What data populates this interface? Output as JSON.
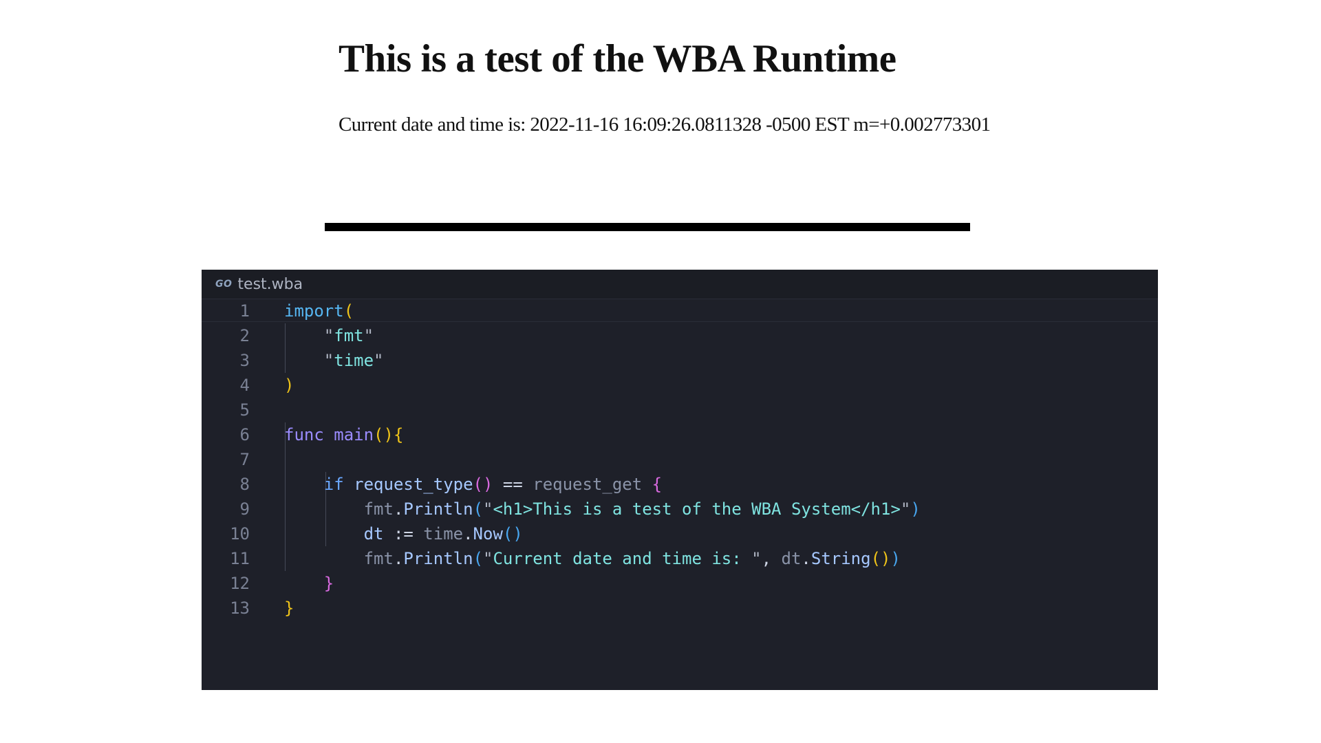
{
  "page": {
    "title": "This is a test of the WBA Runtime",
    "output_text": "Current date and time is: 2022-11-16 16:09:26.0811328 -0500 EST m=+0.002773301"
  },
  "editor": {
    "tab": {
      "icon": "GO",
      "filename": "test.wba"
    },
    "lines": [
      {
        "num": "1",
        "tokens": [
          {
            "t": "import",
            "c": "kw"
          },
          {
            "t": "(",
            "c": "p1"
          }
        ]
      },
      {
        "num": "2",
        "tokens": [
          {
            "t": "    ",
            "c": "op"
          },
          {
            "t": "\"",
            "c": "qt"
          },
          {
            "t": "fmt",
            "c": "str"
          },
          {
            "t": "\"",
            "c": "qt"
          }
        ]
      },
      {
        "num": "3",
        "tokens": [
          {
            "t": "    ",
            "c": "op"
          },
          {
            "t": "\"",
            "c": "qt"
          },
          {
            "t": "time",
            "c": "str"
          },
          {
            "t": "\"",
            "c": "qt"
          }
        ]
      },
      {
        "num": "4",
        "tokens": [
          {
            "t": ")",
            "c": "p1"
          }
        ]
      },
      {
        "num": "5",
        "tokens": []
      },
      {
        "num": "6",
        "tokens": [
          {
            "t": "func",
            "c": "pl"
          },
          {
            "t": " ",
            "c": "op"
          },
          {
            "t": "main",
            "c": "pl"
          },
          {
            "t": "()",
            "c": "p1"
          },
          {
            "t": "{",
            "c": "p1"
          }
        ]
      },
      {
        "num": "7",
        "tokens": []
      },
      {
        "num": "8",
        "tokens": [
          {
            "t": "    ",
            "c": "op"
          },
          {
            "t": "if",
            "c": "ctl"
          },
          {
            "t": " ",
            "c": "op"
          },
          {
            "t": "request_type",
            "c": "fn"
          },
          {
            "t": "()",
            "c": "p2"
          },
          {
            "t": " == ",
            "c": "op"
          },
          {
            "t": "request_get",
            "c": "dim"
          },
          {
            "t": " ",
            "c": "op"
          },
          {
            "t": "{",
            "c": "p2"
          }
        ]
      },
      {
        "num": "9",
        "tokens": [
          {
            "t": "        ",
            "c": "op"
          },
          {
            "t": "fmt",
            "c": "dim"
          },
          {
            "t": ".",
            "c": "op"
          },
          {
            "t": "Println",
            "c": "fn"
          },
          {
            "t": "(",
            "c": "p3"
          },
          {
            "t": "\"",
            "c": "qt"
          },
          {
            "t": "<h1>This is a test of the WBA System</h1>",
            "c": "str"
          },
          {
            "t": "\"",
            "c": "qt"
          },
          {
            "t": ")",
            "c": "p3"
          }
        ]
      },
      {
        "num": "10",
        "tokens": [
          {
            "t": "        ",
            "c": "op"
          },
          {
            "t": "dt",
            "c": "fn"
          },
          {
            "t": " := ",
            "c": "op"
          },
          {
            "t": "time",
            "c": "dim"
          },
          {
            "t": ".",
            "c": "op"
          },
          {
            "t": "Now",
            "c": "fn"
          },
          {
            "t": "()",
            "c": "p3"
          }
        ]
      },
      {
        "num": "11",
        "tokens": [
          {
            "t": "        ",
            "c": "op"
          },
          {
            "t": "fmt",
            "c": "dim"
          },
          {
            "t": ".",
            "c": "op"
          },
          {
            "t": "Println",
            "c": "fn"
          },
          {
            "t": "(",
            "c": "p3"
          },
          {
            "t": "\"",
            "c": "qt"
          },
          {
            "t": "Current date and time is: ",
            "c": "str"
          },
          {
            "t": "\"",
            "c": "qt"
          },
          {
            "t": ", ",
            "c": "op"
          },
          {
            "t": "dt",
            "c": "dim"
          },
          {
            "t": ".",
            "c": "op"
          },
          {
            "t": "String",
            "c": "fn"
          },
          {
            "t": "()",
            "c": "p1"
          },
          {
            "t": ")",
            "c": "p3"
          }
        ]
      },
      {
        "num": "12",
        "tokens": [
          {
            "t": "    ",
            "c": "op"
          },
          {
            "t": "}",
            "c": "p2"
          }
        ]
      },
      {
        "num": "13",
        "tokens": [
          {
            "t": "}",
            "c": "p1"
          }
        ]
      }
    ]
  },
  "colors": {
    "editor_background": "#1e2029",
    "tab_bar_background": "#1b1d24",
    "keyword": "#56b6f2",
    "string": "#7fe3e0",
    "bracket_level_1": "#f0c419",
    "bracket_level_2": "#d96ae0",
    "bracket_level_3": "#48a6f0",
    "line_number": "#7a8194"
  }
}
